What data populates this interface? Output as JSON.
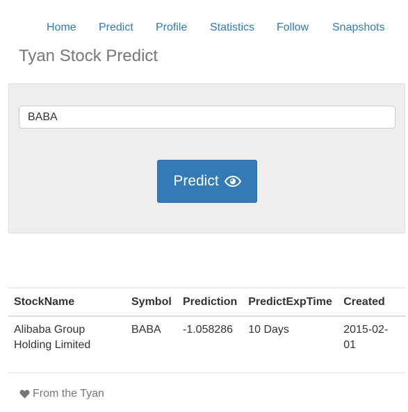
{
  "nav": {
    "items": [
      {
        "label": "Home"
      },
      {
        "label": "Predict"
      },
      {
        "label": "Profile"
      },
      {
        "label": "Statistics"
      },
      {
        "label": "Follow"
      },
      {
        "label": "Snapshots"
      }
    ]
  },
  "header": {
    "title": "Tyan Stock Predict"
  },
  "search": {
    "value": "BABA",
    "button_label": "Predict",
    "button_icon": "eye-icon",
    "panel_color": "#eeeeee",
    "button_color": "#337ab7"
  },
  "table": {
    "columns": [
      "StockName",
      "Symbol",
      "Prediction",
      "PredictExpTime",
      "Created"
    ],
    "rows": [
      {
        "stock_name": "Alibaba Group Holding Limited",
        "symbol": "BABA",
        "prediction": "-1.058286",
        "predict_exp_time": "10 Days",
        "created": "2015-02-01"
      }
    ]
  },
  "footer": {
    "icon": "heart-icon",
    "text": "From the Tyan"
  }
}
